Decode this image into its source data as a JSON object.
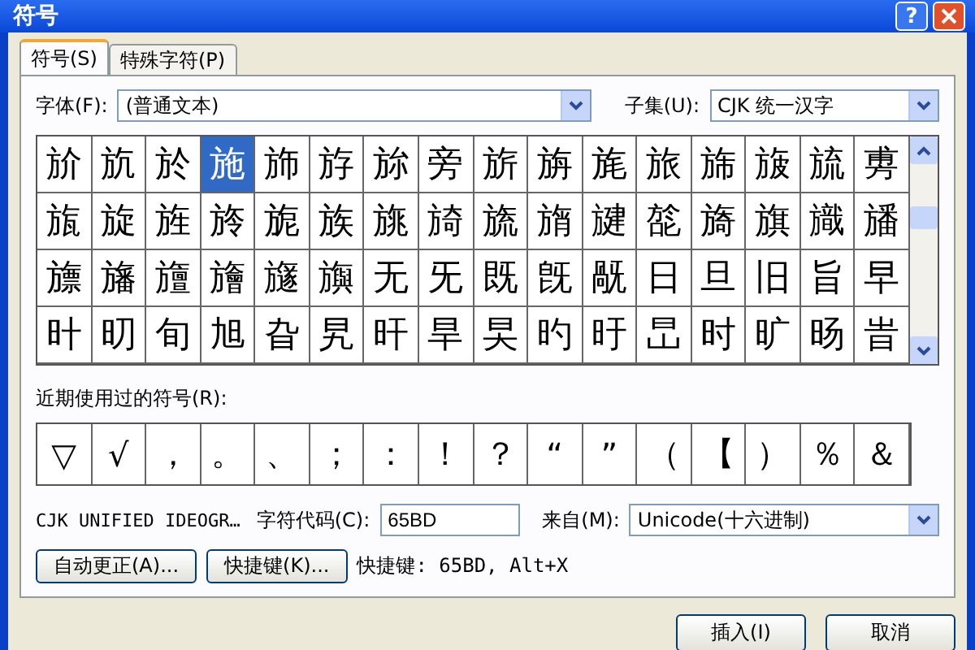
{
  "window": {
    "title": "符号",
    "help": "?"
  },
  "tabs": [
    {
      "label": "符号(S)",
      "selected": true
    },
    {
      "label": "特殊字符(P)",
      "selected": false
    }
  ],
  "font_field": {
    "label": "字体(F):",
    "value": "(普通文本)"
  },
  "subset_field": {
    "label": "子集(U):",
    "value": "CJK 统一汉字"
  },
  "symbol_grid": [
    {
      "cells": [
        {
          "char": "斺",
          "selected": false
        },
        {
          "char": "斻",
          "selected": false
        },
        {
          "char": "於",
          "selected": false
        },
        {
          "char": "施",
          "selected": true
        },
        {
          "char": "斾",
          "selected": false
        },
        {
          "char": "斿",
          "selected": false
        },
        {
          "char": "旀",
          "selected": false
        },
        {
          "char": "旁",
          "selected": false
        },
        {
          "char": "旂",
          "selected": false
        },
        {
          "char": "旃",
          "selected": false
        },
        {
          "char": "旄",
          "selected": false
        },
        {
          "char": "旅",
          "selected": false
        },
        {
          "char": "旆",
          "selected": false
        },
        {
          "char": "旇",
          "selected": false
        },
        {
          "char": "旈",
          "selected": false
        },
        {
          "char": "旉",
          "selected": false
        }
      ]
    },
    {
      "cells": [
        {
          "char": "旊",
          "selected": false
        },
        {
          "char": "旋",
          "selected": false
        },
        {
          "char": "旌",
          "selected": false
        },
        {
          "char": "旍",
          "selected": false
        },
        {
          "char": "旎",
          "selected": false
        },
        {
          "char": "族",
          "selected": false
        },
        {
          "char": "旐",
          "selected": false
        },
        {
          "char": "旑",
          "selected": false
        },
        {
          "char": "旒",
          "selected": false
        },
        {
          "char": "旓",
          "selected": false
        },
        {
          "char": "旔",
          "selected": false
        },
        {
          "char": "旕",
          "selected": false
        },
        {
          "char": "旖",
          "selected": false
        },
        {
          "char": "旗",
          "selected": false
        },
        {
          "char": "旘",
          "selected": false
        },
        {
          "char": "旙",
          "selected": false
        }
      ]
    },
    {
      "cells": [
        {
          "char": "旚",
          "selected": false
        },
        {
          "char": "旛",
          "selected": false
        },
        {
          "char": "旜",
          "selected": false
        },
        {
          "char": "旝",
          "selected": false
        },
        {
          "char": "旞",
          "selected": false
        },
        {
          "char": "旟",
          "selected": false
        },
        {
          "char": "无",
          "selected": false
        },
        {
          "char": "旡",
          "selected": false
        },
        {
          "char": "既",
          "selected": false
        },
        {
          "char": "旣",
          "selected": false
        },
        {
          "char": "旤",
          "selected": false
        },
        {
          "char": "日",
          "selected": false
        },
        {
          "char": "旦",
          "selected": false
        },
        {
          "char": "旧",
          "selected": false
        },
        {
          "char": "旨",
          "selected": false
        },
        {
          "char": "早",
          "selected": false
        }
      ]
    },
    {
      "cells": [
        {
          "char": "旪",
          "selected": false
        },
        {
          "char": "旫",
          "selected": false
        },
        {
          "char": "旬",
          "selected": false
        },
        {
          "char": "旭",
          "selected": false
        },
        {
          "char": "旮",
          "selected": false
        },
        {
          "char": "旯",
          "selected": false
        },
        {
          "char": "旰",
          "selected": false
        },
        {
          "char": "旱",
          "selected": false
        },
        {
          "char": "旲",
          "selected": false
        },
        {
          "char": "旳",
          "selected": false
        },
        {
          "char": "旴",
          "selected": false
        },
        {
          "char": "旵",
          "selected": false
        },
        {
          "char": "时",
          "selected": false
        },
        {
          "char": "旷",
          "selected": false
        },
        {
          "char": "旸",
          "selected": false
        },
        {
          "char": "旹",
          "selected": false
        }
      ]
    }
  ],
  "recent_label": "近期使用过的符号(R):",
  "recent_symbols": [
    "▽",
    "√",
    "，",
    "。",
    "、",
    "；",
    "：",
    "！",
    "？",
    "“",
    "”",
    "（",
    "【",
    "）",
    "％",
    "＆"
  ],
  "char_name": "CJK UNIFIED IDEOGR…",
  "code_field": {
    "label": "字符代码(C):",
    "value": "65BD"
  },
  "from_field": {
    "label": "来自(M):",
    "value": "Unicode(十六进制)"
  },
  "option_buttons": [
    "自动更正(A)...",
    "快捷键(K)..."
  ],
  "shortcut_text": "快捷键: 65BD, Alt+X",
  "footer_buttons": [
    "插入(I)",
    "取消"
  ]
}
